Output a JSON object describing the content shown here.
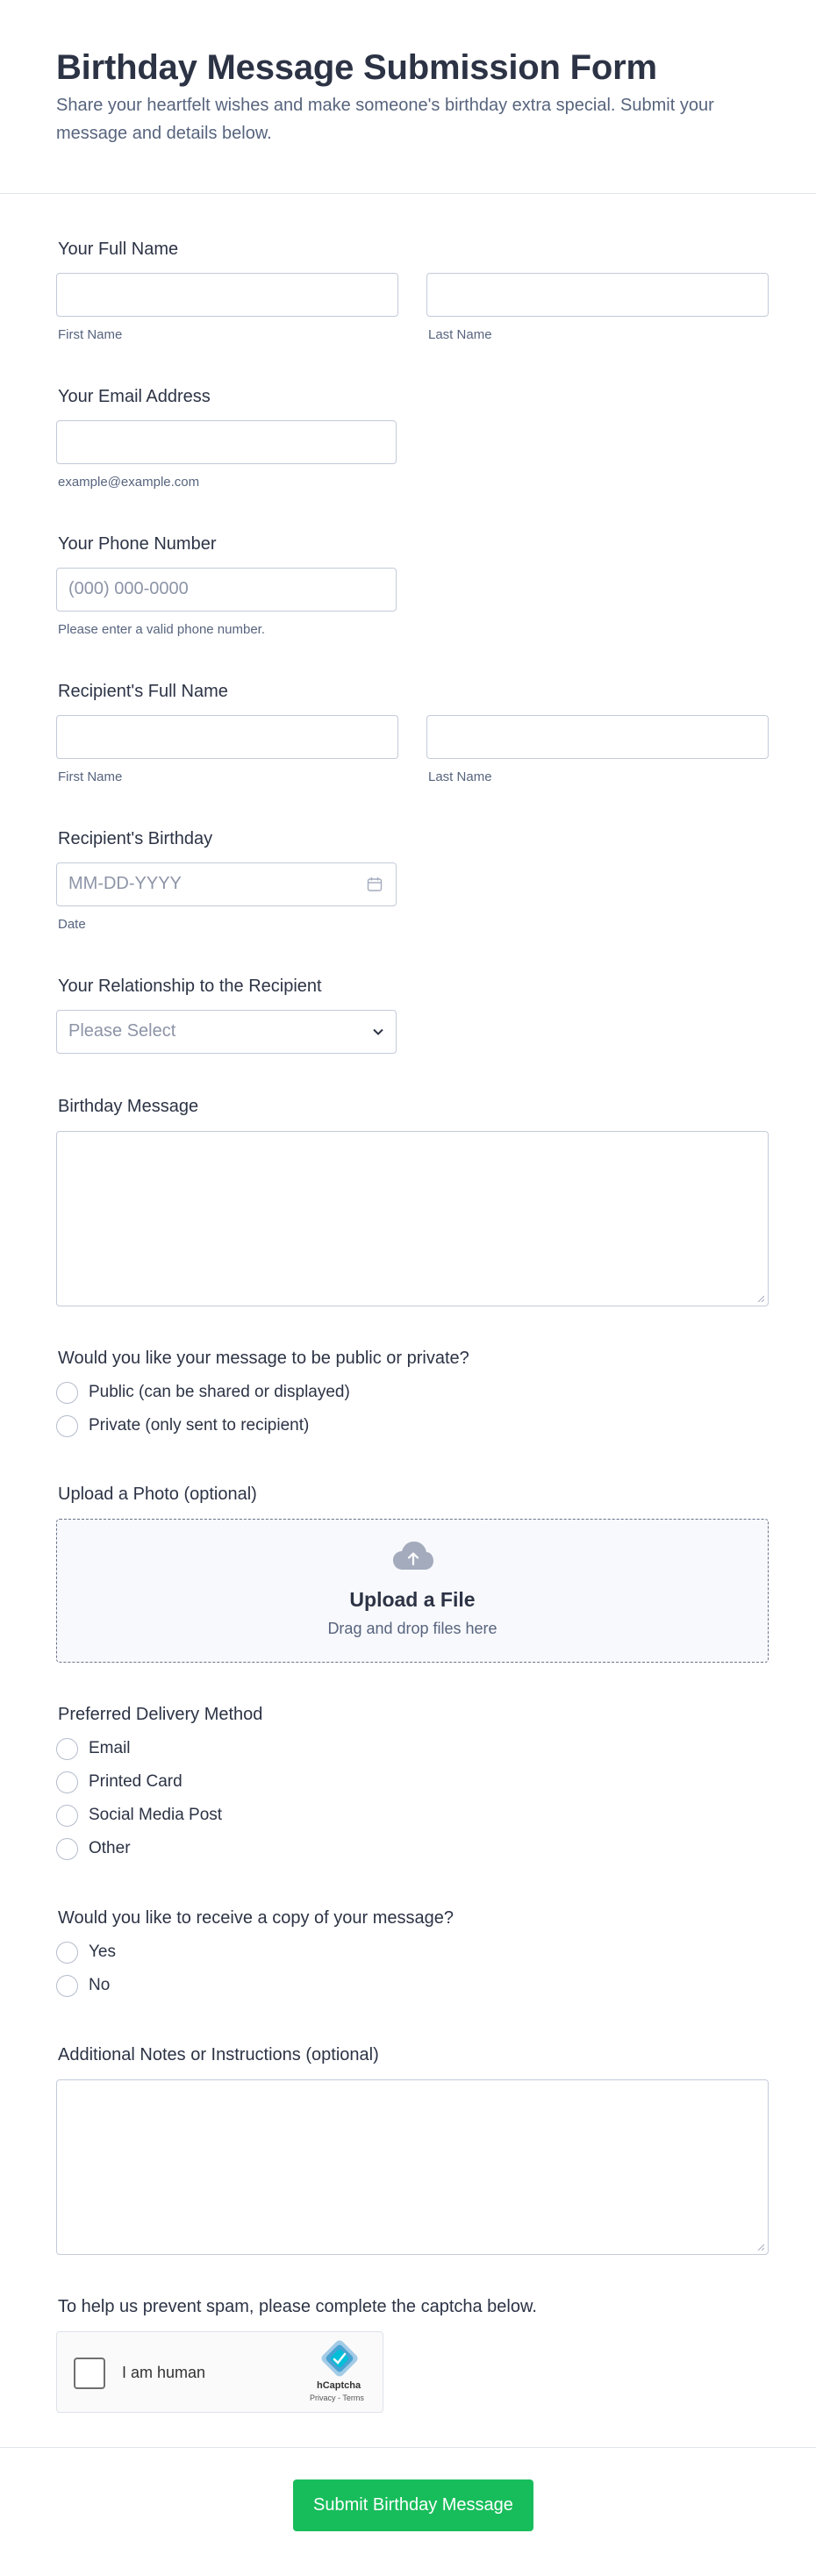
{
  "header": {
    "title": "Birthday Message Submission Form",
    "subtitle": "Share your heartfelt wishes and make someone's birthday extra special. Submit your message and details below."
  },
  "fields": {
    "full_name": {
      "label": "Your Full Name",
      "first": "First Name",
      "last": "Last Name"
    },
    "email": {
      "label": "Your Email Address",
      "sublabel": "example@example.com"
    },
    "phone": {
      "label": "Your Phone Number",
      "placeholder": "(000) 000-0000",
      "sublabel": "Please enter a valid phone number."
    },
    "recipient_name": {
      "label": "Recipient's Full Name",
      "first": "First Name",
      "last": "Last Name"
    },
    "birthday": {
      "label": "Recipient's Birthday",
      "placeholder": "MM-DD-YYYY",
      "sublabel": "Date"
    },
    "relationship": {
      "label": "Your Relationship to the Recipient",
      "placeholder": "Please Select"
    },
    "message": {
      "label": "Birthday Message"
    },
    "visibility": {
      "label": "Would you like your message to be public or private?",
      "options": [
        "Public (can be shared or displayed)",
        "Private (only sent to recipient)"
      ]
    },
    "photo": {
      "label": "Upload a Photo (optional)",
      "title": "Upload a File",
      "sub": "Drag and drop files here"
    },
    "delivery": {
      "label": "Preferred Delivery Method",
      "options": [
        "Email",
        "Printed Card",
        "Social Media Post",
        "Other"
      ]
    },
    "copy": {
      "label": "Would you like to receive a copy of your message?",
      "options": [
        "Yes",
        "No"
      ]
    },
    "notes": {
      "label": "Additional Notes or Instructions (optional)"
    },
    "captcha": {
      "label": "To help us prevent spam, please complete the captcha below.",
      "text": "I am human",
      "brand": "hCaptcha",
      "links": "Privacy - Terms"
    }
  },
  "submit": {
    "label": "Submit Birthday Message"
  },
  "colors": {
    "accent": "#18bd5b",
    "border": "#c3cad8",
    "text": "#2c3345",
    "muted": "#57647e"
  }
}
